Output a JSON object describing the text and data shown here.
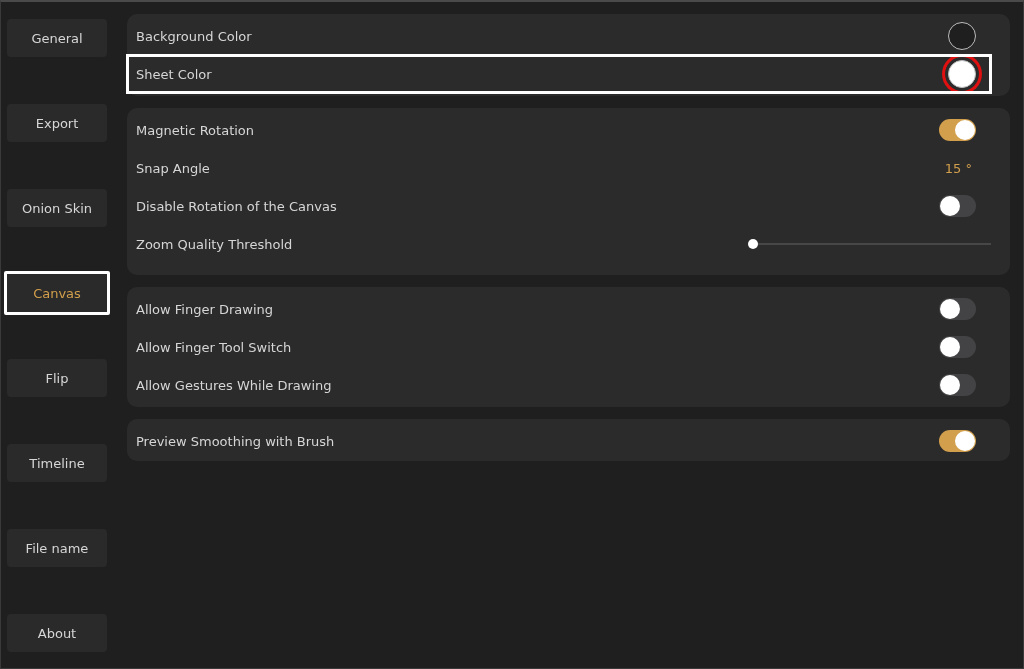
{
  "sidebar": {
    "items": [
      {
        "label": "General",
        "selected": false,
        "highlighted": false
      },
      {
        "label": "Export",
        "selected": false,
        "highlighted": false
      },
      {
        "label": "Onion Skin",
        "selected": false,
        "highlighted": false
      },
      {
        "label": "Canvas",
        "selected": true,
        "highlighted": true
      },
      {
        "label": "Flip",
        "selected": false,
        "highlighted": false
      },
      {
        "label": "Timeline",
        "selected": false,
        "highlighted": false
      },
      {
        "label": "File name",
        "selected": false,
        "highlighted": false
      },
      {
        "label": "About",
        "selected": false,
        "highlighted": false
      }
    ]
  },
  "groups": [
    {
      "rows": [
        {
          "kind": "color",
          "label": "Background Color",
          "color": "#1f1f1f",
          "highlighted": false,
          "circled": false
        },
        {
          "kind": "color",
          "label": "Sheet Color",
          "color": "#ffffff",
          "highlighted": true,
          "circled": true
        }
      ]
    },
    {
      "rows": [
        {
          "kind": "toggle",
          "label": "Magnetic Rotation",
          "on": true
        },
        {
          "kind": "value",
          "label": "Snap Angle",
          "value": "15 °"
        },
        {
          "kind": "toggle",
          "label": "Disable Rotation of the Canvas",
          "on": false
        },
        {
          "kind": "slider",
          "label": "Zoom Quality Threshold",
          "level": 0
        }
      ]
    },
    {
      "rows": [
        {
          "kind": "toggle",
          "label": "Allow Finger Drawing",
          "on": false
        },
        {
          "kind": "toggle",
          "label": "Allow Finger Tool Switch",
          "on": false
        },
        {
          "kind": "toggle",
          "label": "Allow Gestures While Drawing",
          "on": false
        }
      ]
    },
    {
      "rows": [
        {
          "kind": "toggle",
          "label": "Preview Smoothing with Brush",
          "on": true
        }
      ]
    }
  ]
}
